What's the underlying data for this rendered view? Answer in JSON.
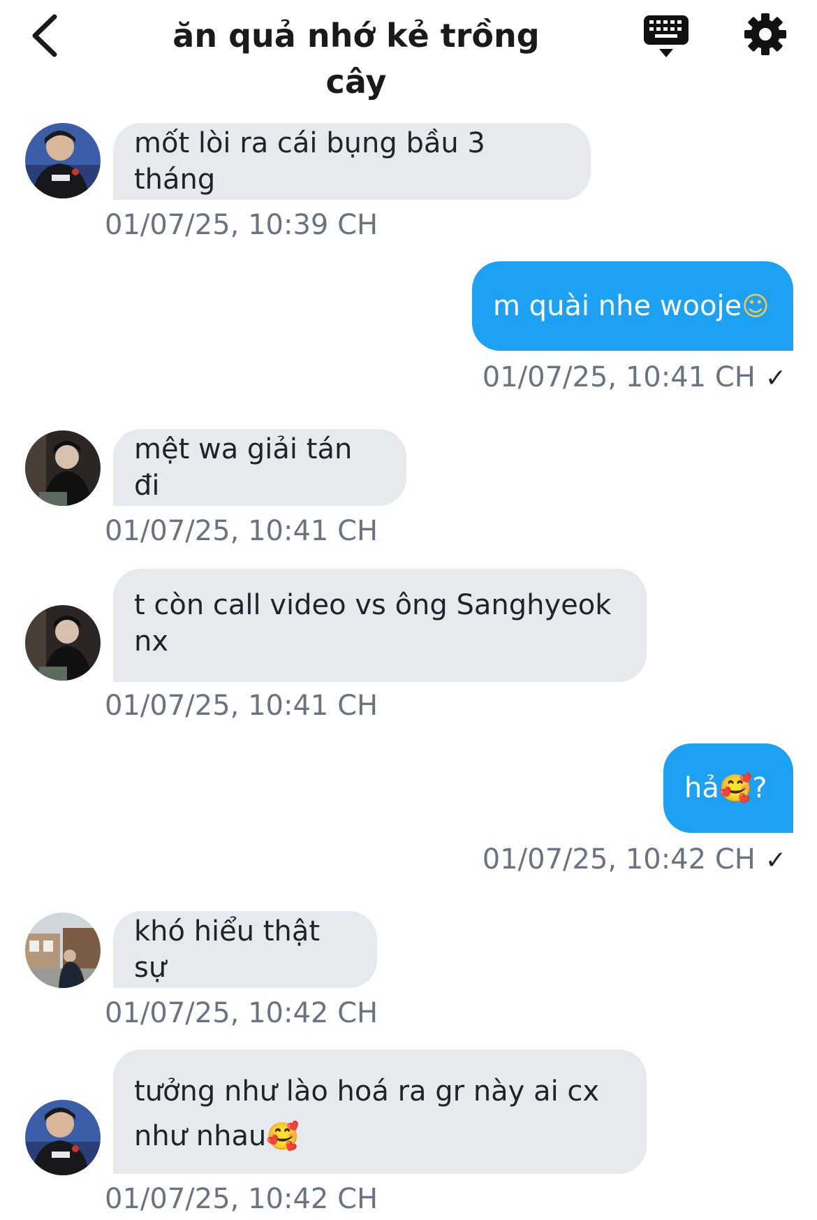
{
  "header": {
    "title": "ăn quả nhớ kẻ trồng cây"
  },
  "messages": [
    {
      "id": "m1",
      "dir": "in",
      "avatar": "avatar-jersey",
      "text": "mốt lòi ra cái bụng bầu 3 tháng",
      "time": "01/07/25, 10:39 CH"
    },
    {
      "id": "m2",
      "dir": "out",
      "text": "m quài nhe wooje",
      "emoji": "☺",
      "time": "01/07/25, 10:41 CH",
      "check": "✓"
    },
    {
      "id": "m3",
      "dir": "in",
      "avatar": "avatar-dark",
      "text": "mệt wa giải tán đi",
      "time": "01/07/25, 10:41 CH"
    },
    {
      "id": "m4",
      "dir": "in",
      "avatar": "avatar-dark",
      "text_line1": "t còn call video vs ông Sanghyeok",
      "text_line2": "nx",
      "time": "01/07/25, 10:41 CH"
    },
    {
      "id": "m5",
      "dir": "out",
      "text": "hả",
      "emoji": "🥰",
      "text_after": " ?",
      "time": "01/07/25, 10:42 CH",
      "check": "✓"
    },
    {
      "id": "m6",
      "dir": "in",
      "avatar": "avatar-street",
      "text": "khó hiểu thật sự",
      "time": "01/07/25, 10:42 CH"
    },
    {
      "id": "m7",
      "dir": "in",
      "avatar": "avatar-jersey",
      "text_line1": "tưởng như lào hoá ra gr này ai cx",
      "text_line2": "như nhau",
      "emoji": "🥰",
      "time": "01/07/25, 10:42 CH"
    }
  ]
}
